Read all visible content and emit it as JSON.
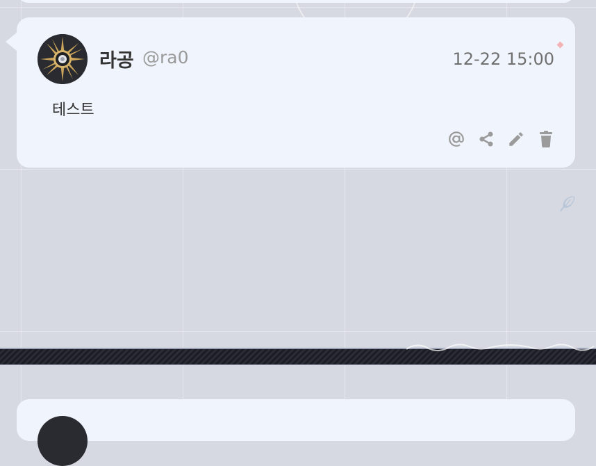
{
  "post": {
    "display_name": "라공",
    "handle": "@ra0",
    "timestamp": "12-22 15:00",
    "body": "테스트",
    "avatar_icon": "sun-emblem-avatar",
    "actions": [
      {
        "icon": "mention-icon"
      },
      {
        "icon": "share-icon"
      },
      {
        "icon": "edit-icon"
      },
      {
        "icon": "delete-icon"
      }
    ]
  },
  "colors": {
    "background": "#d6d9e1",
    "card": "#f0f4fd",
    "action_icon": "#9b9b9b",
    "status_dot": "#f3b2b5"
  }
}
